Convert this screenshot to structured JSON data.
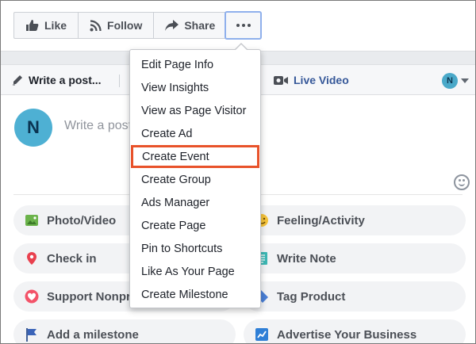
{
  "top_actions": {
    "like_label": "Like",
    "follow_label": "Follow",
    "share_label": "Share"
  },
  "composer": {
    "tabs": {
      "write_post": "Write a post...",
      "live_video": "Live Video"
    },
    "page_avatar_letter": "N",
    "placeholder": "Write a post"
  },
  "quick_actions": [
    {
      "label": "Photo/Video",
      "icon": "photo-icon"
    },
    {
      "label": "Feeling/Activity",
      "icon": "feeling-icon"
    },
    {
      "label": "Check in",
      "icon": "location-pin-icon"
    },
    {
      "label": "Write Note",
      "icon": "note-icon"
    },
    {
      "label": "Support Nonprofit",
      "icon": "nonprofit-heart-icon"
    },
    {
      "label": "Tag Product",
      "icon": "tag-icon"
    },
    {
      "label": "Add a milestone",
      "icon": "flag-icon"
    },
    {
      "label": "Advertise Your Business",
      "icon": "advertise-icon"
    }
  ],
  "more_menu": {
    "items": [
      "Edit Page Info",
      "View Insights",
      "View as Page Visitor",
      "Create Ad",
      "Create Event",
      "Create Group",
      "Ads Manager",
      "Create Page",
      "Pin to Shortcuts",
      "Like As Your Page",
      "Create Milestone"
    ],
    "highlighted": "Create Event"
  },
  "colors": {
    "accent_blue": "#365899",
    "highlight_outline": "#e8522a",
    "avatar": "#4eb0d3"
  }
}
